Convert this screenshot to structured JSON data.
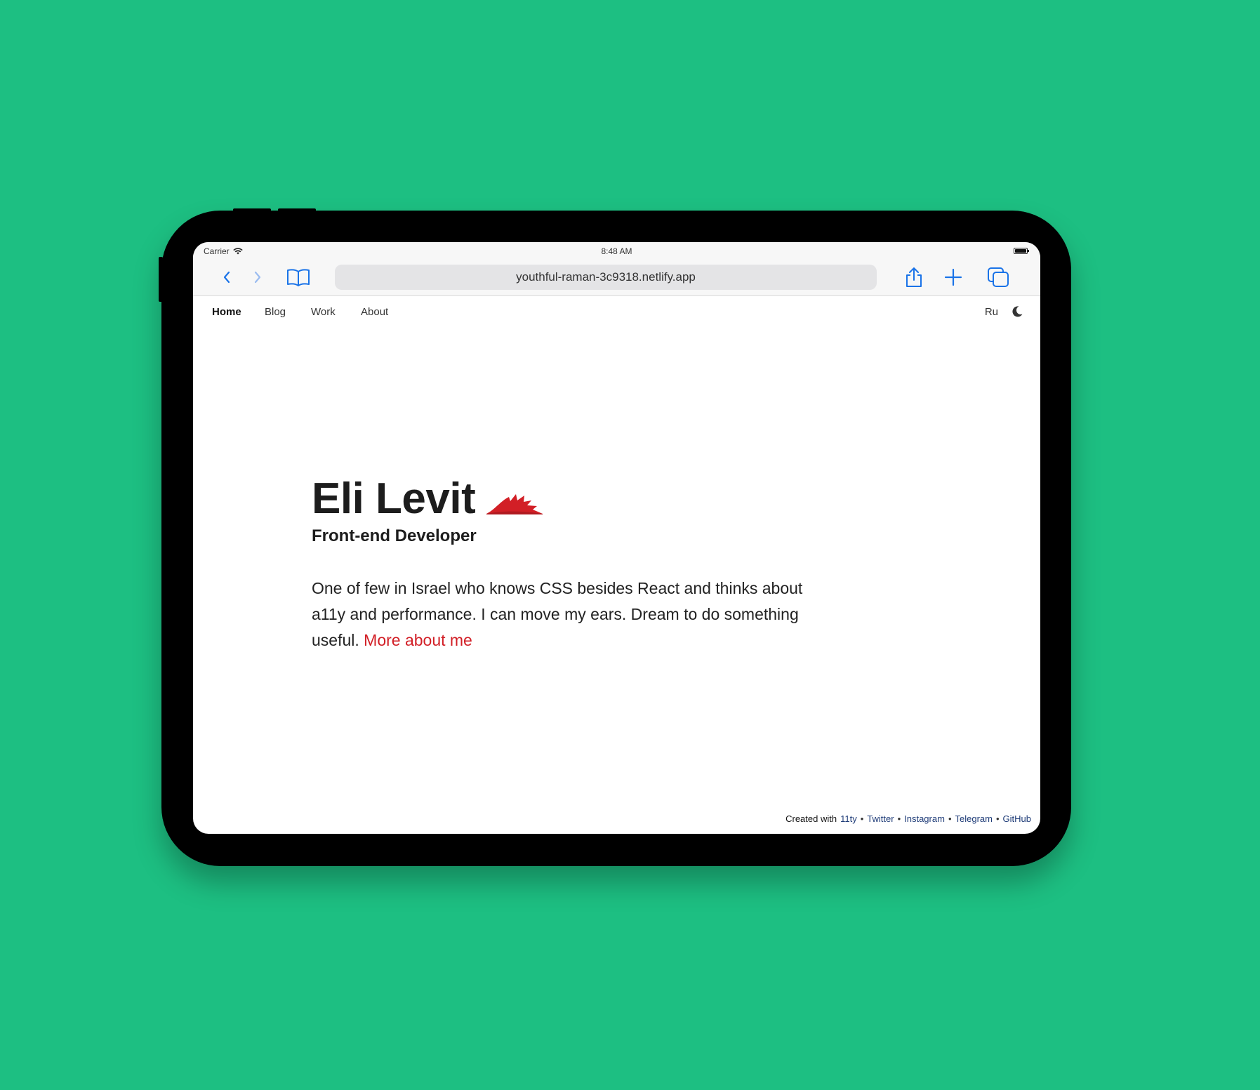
{
  "status_bar": {
    "carrier": "Carrier",
    "time": "8:48 AM"
  },
  "browser": {
    "url": "youthful-raman-3c9318.netlify.app",
    "accent_color": "#1a73e8",
    "icons": [
      "chevron-left-icon",
      "chevron-right-icon",
      "book-icon",
      "share-icon",
      "plus-icon",
      "tabs-icon"
    ]
  },
  "site_nav": {
    "items": [
      {
        "label": "Home",
        "active": true
      },
      {
        "label": "Blog",
        "active": false
      },
      {
        "label": "Work",
        "active": false
      },
      {
        "label": "About",
        "active": false
      }
    ],
    "lang": "Ru",
    "theme_icon": "moon-icon"
  },
  "hero": {
    "name": "Eli Levit",
    "role": "Front-end Developer",
    "text": "One of few in Israel who knows CSS besides React and thinks about a11y and performance. I can move my ears. Dream to do something useful.",
    "link_label": "More about me",
    "link_color": "#d21f26"
  },
  "footer": {
    "prefix": "Created with",
    "links": [
      "11ty",
      "Twitter",
      "Instagram",
      "Telegram",
      "GitHub"
    ],
    "separator": "•"
  },
  "background_color": "#1dbf82"
}
